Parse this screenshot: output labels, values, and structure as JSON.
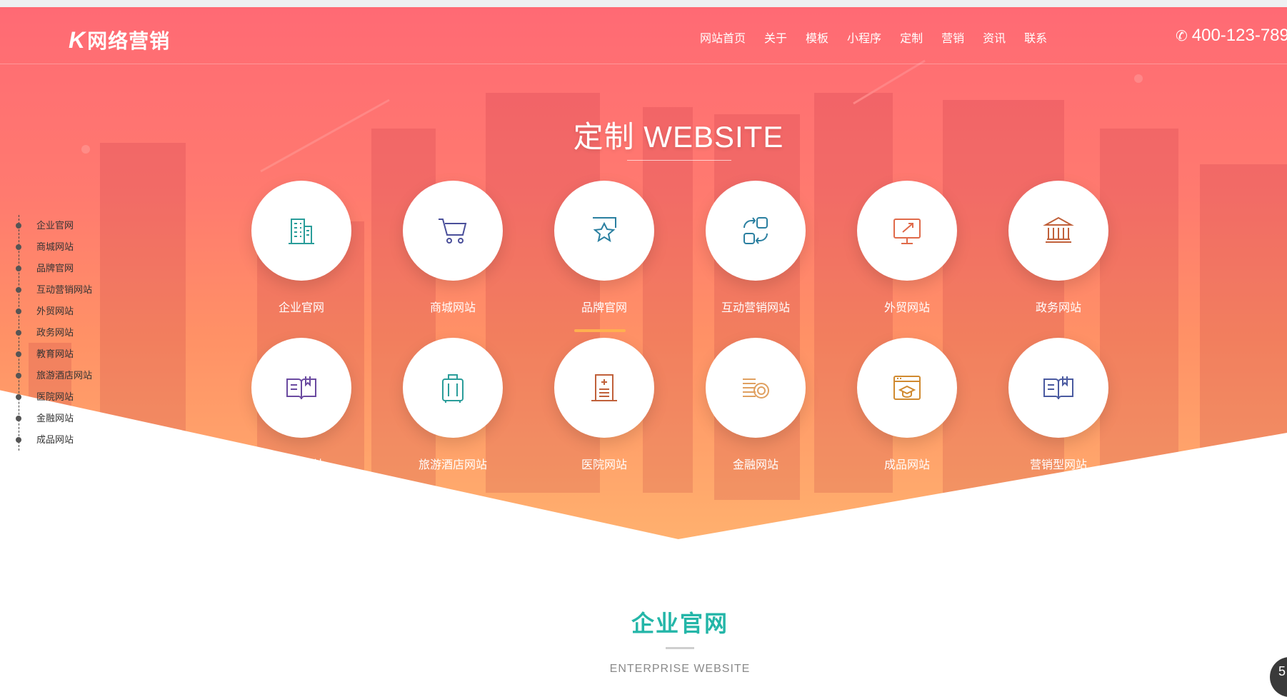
{
  "brand": {
    "logo_mark": "K",
    "logo_text": "网络营销"
  },
  "nav": [
    "网站首页",
    "关于",
    "模板",
    "小程序",
    "定制",
    "营销",
    "资讯",
    "联系"
  ],
  "phone": "400-123-789",
  "hero": {
    "title": "定制  WEBSITE"
  },
  "side_nav": [
    "企业官网",
    "商城网站",
    "品牌官网",
    "互动营销网站",
    "外贸网站",
    "政务网站",
    "教育网站",
    "旅游酒店网站",
    "医院网站",
    "金融网站",
    "成品网站"
  ],
  "cards": [
    {
      "label": "企业官网",
      "icon": "building-icon",
      "color": "#2a9d9a"
    },
    {
      "label": "商城网站",
      "icon": "cart-icon",
      "color": "#4a4f9a"
    },
    {
      "label": "品牌官网",
      "icon": "star-badge-icon",
      "color": "#2a7fa0"
    },
    {
      "label": "互动营销网站",
      "icon": "exchange-icon",
      "color": "#2a7fa0"
    },
    {
      "label": "外贸网站",
      "icon": "monitor-share-icon",
      "color": "#e06a4a"
    },
    {
      "label": "政务网站",
      "icon": "government-icon",
      "color": "#c0603a"
    },
    {
      "label": "教育网站",
      "icon": "open-book-icon",
      "color": "#6a4aa0"
    },
    {
      "label": "旅游酒店网站",
      "icon": "suitcase-icon",
      "color": "#2a9d9a"
    },
    {
      "label": "医院网站",
      "icon": "hospital-icon",
      "color": "#c0603a"
    },
    {
      "label": "金融网站",
      "icon": "coins-icon",
      "color": "#e0a060"
    },
    {
      "label": "成品网站",
      "icon": "browser-cap-icon",
      "color": "#d08a30"
    },
    {
      "label": "营销型网站",
      "icon": "open-book-icon",
      "color": "#4a5aa0"
    }
  ],
  "section": {
    "title": "企业官网",
    "subtitle": "ENTERPRISE WEBSITE"
  },
  "float_button": "5"
}
